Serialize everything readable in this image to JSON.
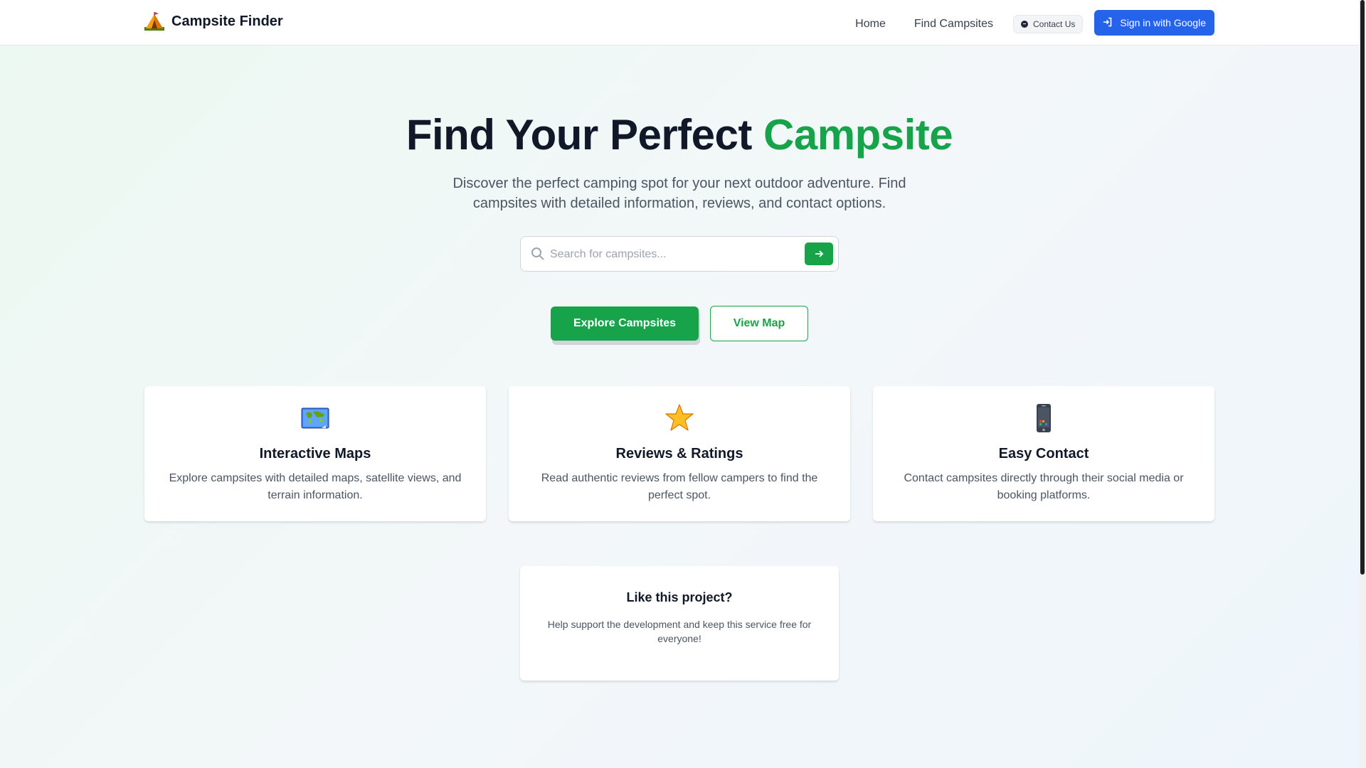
{
  "header": {
    "brand_name": "Campsite Finder",
    "brand_icon": "tent-icon",
    "nav": {
      "home": "Home",
      "find_campsites": "Find Campsites",
      "contact_us": "Contact Us",
      "sign_in": "Sign in with Google"
    }
  },
  "hero": {
    "title_main": "Find Your Perfect",
    "title_accent": "Campsite",
    "subtitle": "Discover the perfect camping spot for your next outdoor adventure. Find campsites with detailed information, reviews, and contact options.",
    "search_placeholder": "Search for campsites...",
    "search_value": "",
    "explore_button": "Explore Campsites",
    "map_button": "View Map"
  },
  "features": [
    {
      "icon": "world-map-icon",
      "title": "Interactive Maps",
      "description": "Explore campsites with detailed maps, satellite views, and terrain information."
    },
    {
      "icon": "star-icon",
      "title": "Reviews & Ratings",
      "description": "Read authentic reviews from fellow campers to find the perfect spot."
    },
    {
      "icon": "mobile-phone-icon",
      "title": "Easy Contact",
      "description": "Contact campsites directly through their social media or booking platforms."
    }
  ],
  "support": {
    "title": "Like this project?",
    "text": "Help support the development and keep this service free for everyone!"
  },
  "colors": {
    "accent_green": "#16a34a",
    "google_blue": "#2563eb",
    "text_dark": "#111827",
    "text_muted": "#4b5563"
  }
}
